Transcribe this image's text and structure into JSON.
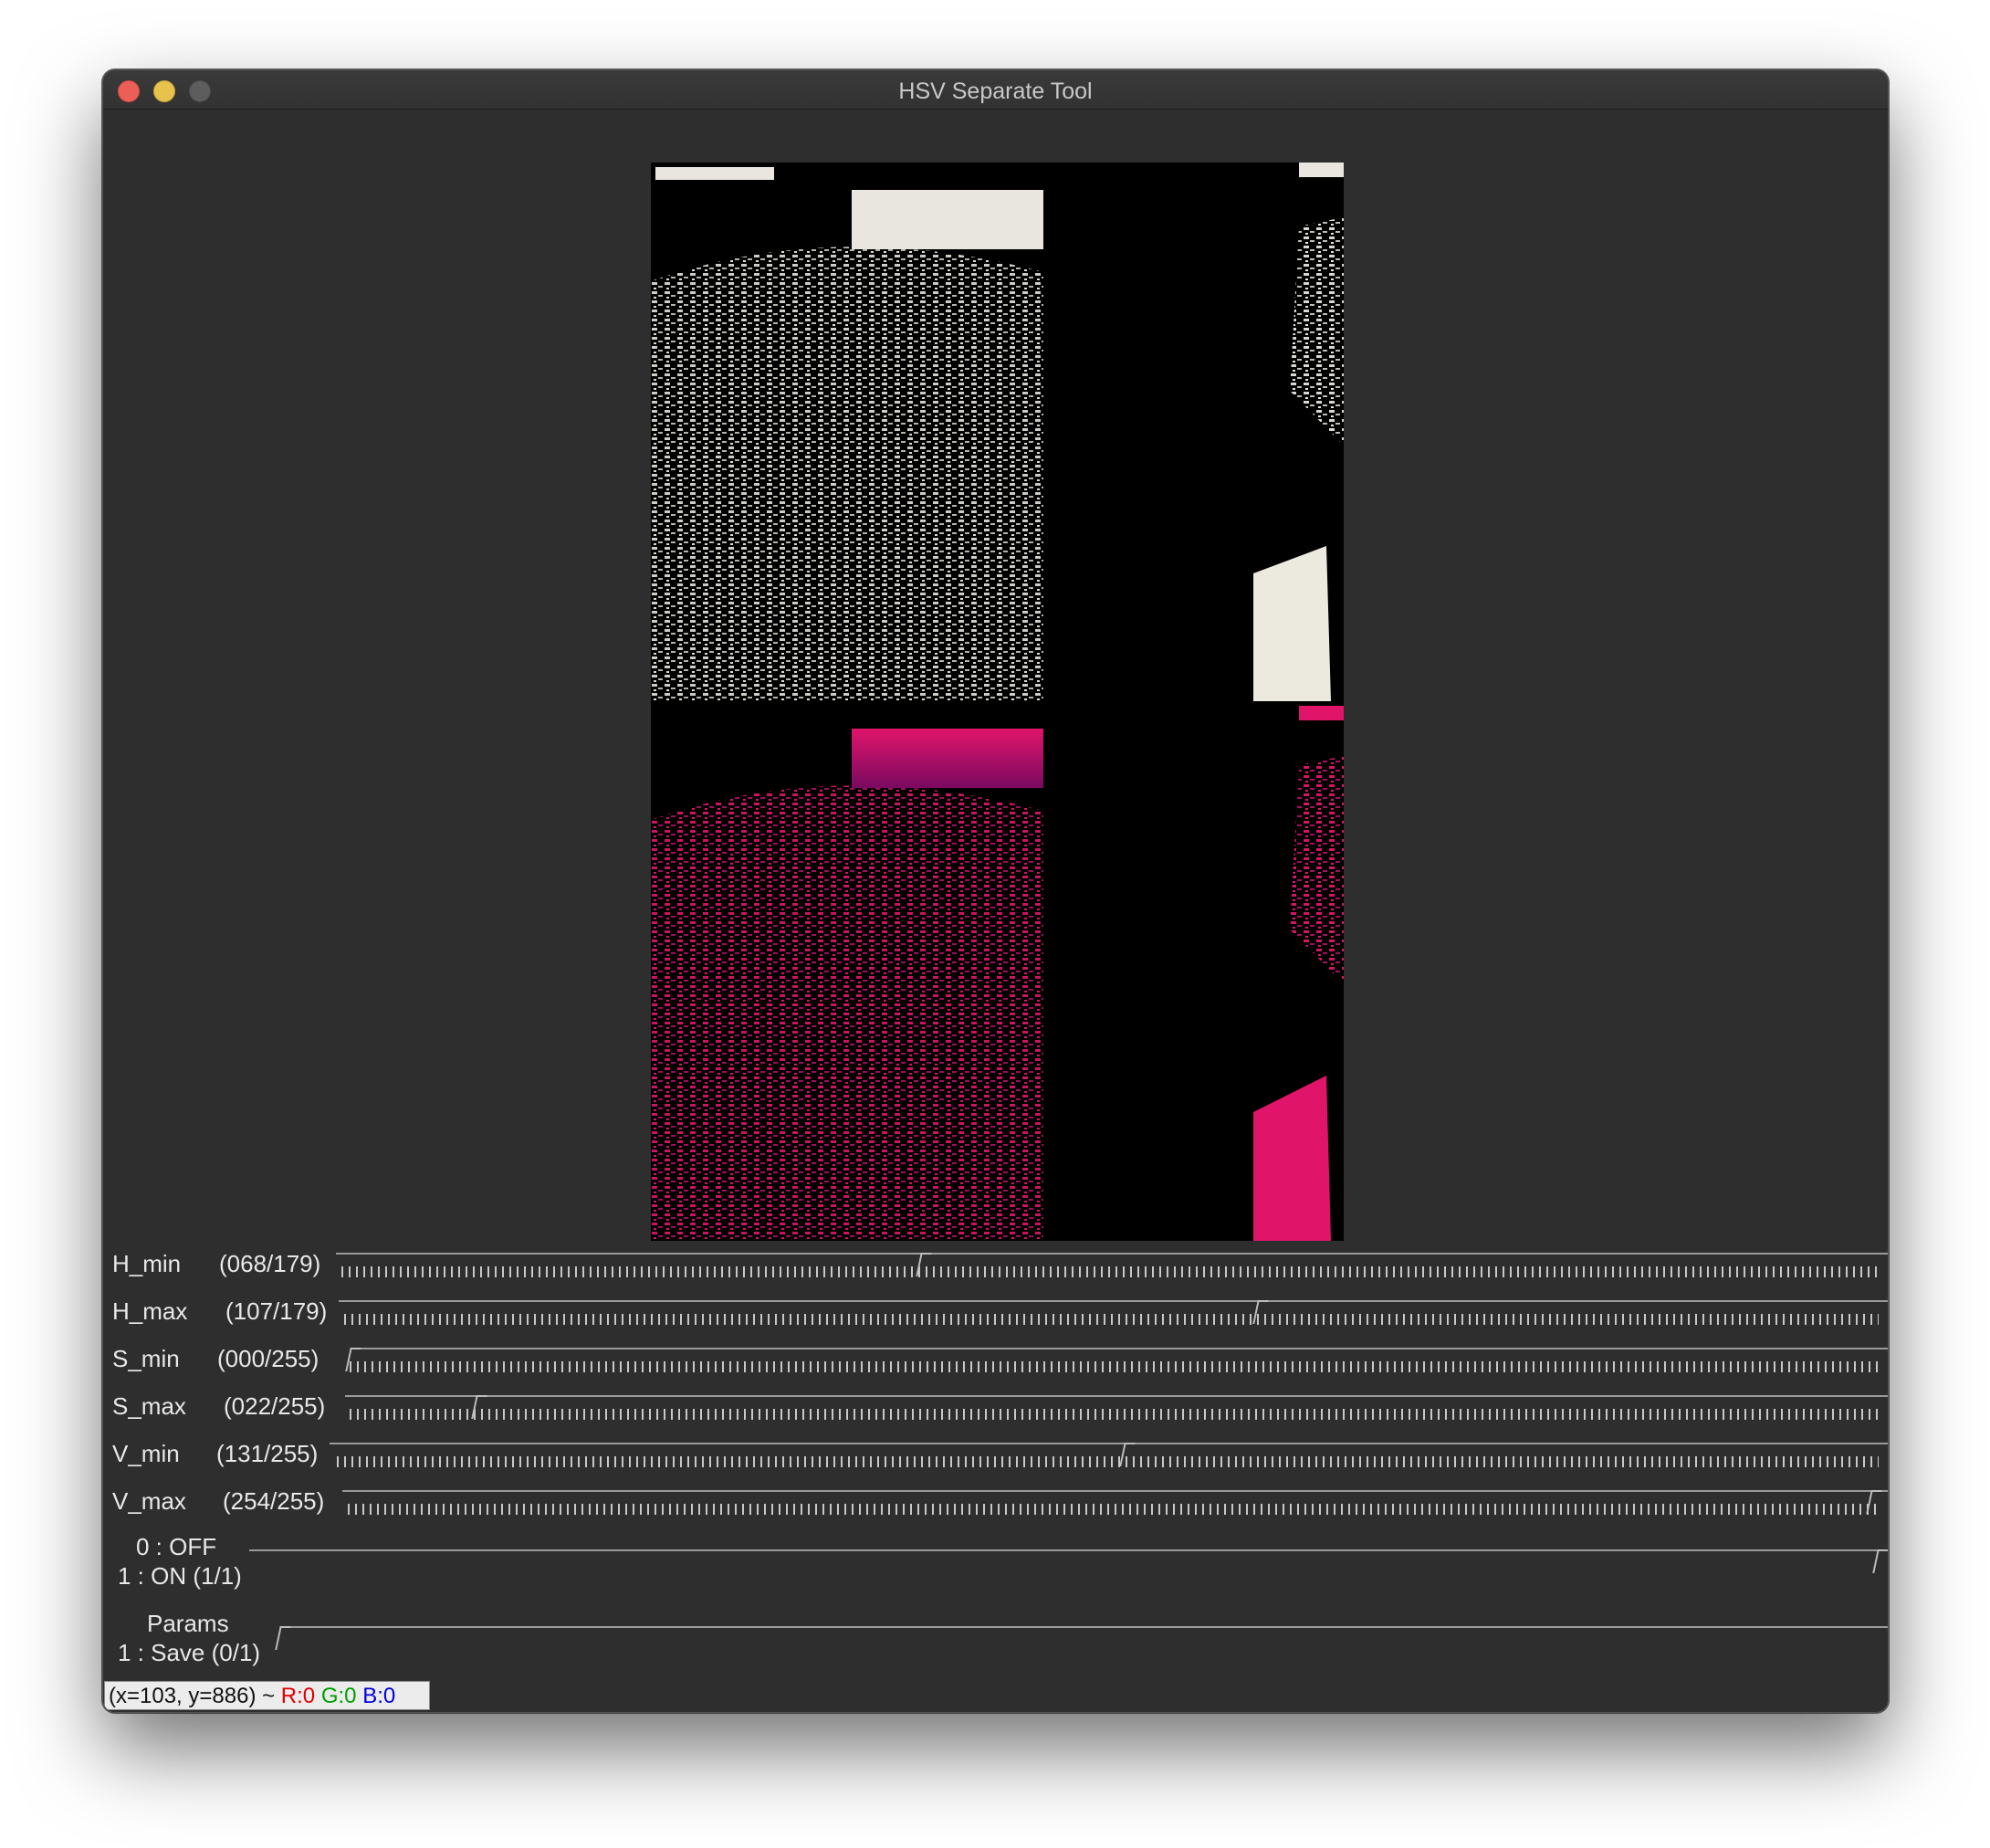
{
  "window": {
    "title": "HSV Separate Tool"
  },
  "sliders": [
    {
      "name": "H_min",
      "display": "(068/179)",
      "value": 68,
      "max": 179
    },
    {
      "name": "H_max",
      "display": "(107/179)",
      "value": 107,
      "max": 179
    },
    {
      "name": "S_min",
      "display": "(000/255)",
      "value": 0,
      "max": 255
    },
    {
      "name": "S_max",
      "display": "(022/255)",
      "value": 22,
      "max": 255
    },
    {
      "name": "V_min",
      "display": "(131/255)",
      "value": 131,
      "max": 255
    },
    {
      "name": "V_max",
      "display": "(254/255)",
      "value": 254,
      "max": 255
    }
  ],
  "toggle": {
    "line1": "0 : OFF",
    "line2": "1 : ON (1/1)",
    "value": 1,
    "max": 1
  },
  "params": {
    "line1": "Params",
    "line2": "1 : Save (0/1)",
    "value": 0,
    "max": 1
  },
  "status": {
    "coords": "(x=103, y=886) ~ ",
    "r": "R:0",
    "g": "G:0",
    "b": "B:0"
  },
  "colors": {
    "window_bg": "#2e2e2e",
    "mask_white": "#e8e6df",
    "mask_pink": "#e0156a"
  },
  "icons": [
    "close-icon",
    "minimize-icon",
    "maximize-icon"
  ]
}
